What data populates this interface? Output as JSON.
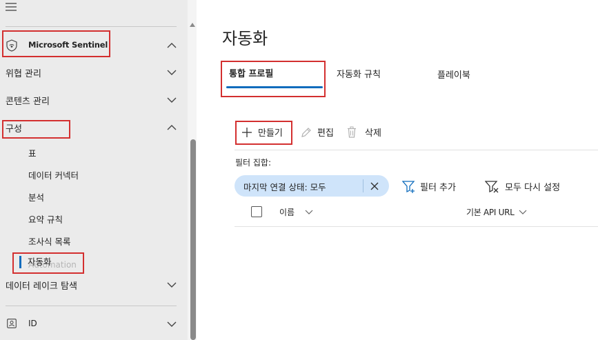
{
  "sidebar": {
    "sentinel_label": "Microsoft Sentinel",
    "sections": {
      "threat": "위협 관리",
      "content": "콘텐츠 관리",
      "config": "구성"
    },
    "config_items": [
      "표",
      "데이터 커넥터",
      "분석",
      "요약 규칙",
      "조사식 목록"
    ],
    "active_item": "자동화",
    "active_item_ghost": "Automation",
    "data_lake": "데이터 레이크 탐색",
    "id_label": "ID"
  },
  "main": {
    "title": "자동화",
    "tabs": [
      "통합 프로필",
      "자동화 규칙",
      "플레이북"
    ],
    "toolbar": {
      "create": "만들기",
      "edit": "편집",
      "delete": "삭제"
    },
    "filter_label": "필터 집합:",
    "filter_pill": "마지막 연결 상태: 모두",
    "add_filter": "필터 추가",
    "reset_all": "모두 다시 설정",
    "columns": [
      "이름",
      "기본 API URL"
    ]
  },
  "colors": {
    "accent": "#0f6cbd",
    "highlight_box": "#d32f2f",
    "pill_bg": "#cfe4fa",
    "sidebar_bg": "#ebebeb"
  }
}
